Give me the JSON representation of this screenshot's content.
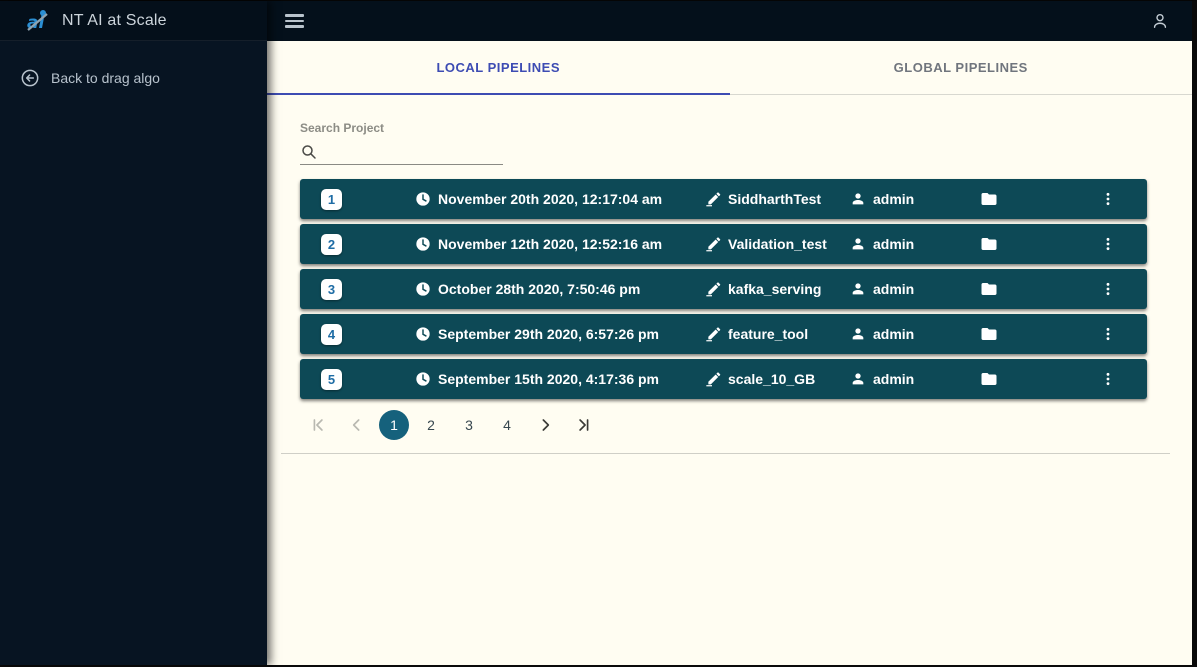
{
  "sidebar": {
    "logo_text": "NT AI at Scale",
    "back_label": "Back to drag algo"
  },
  "tabs": {
    "local": "LOCAL PIPELINES",
    "global": "GLOBAL PIPELINES"
  },
  "search": {
    "label": "Search Project",
    "value": ""
  },
  "pipelines": {
    "rows": [
      {
        "index": "1",
        "date": "November 20th 2020, 12:17:04 am",
        "name": "SiddharthTest",
        "owner": "admin"
      },
      {
        "index": "2",
        "date": "November 12th 2020, 12:52:16 am",
        "name": "Validation_test",
        "owner": "admin"
      },
      {
        "index": "3",
        "date": "October 28th 2020, 7:50:46 pm",
        "name": "kafka_serving",
        "owner": "admin"
      },
      {
        "index": "4",
        "date": "September 29th 2020, 6:57:26 pm",
        "name": "feature_tool",
        "owner": "admin"
      },
      {
        "index": "5",
        "date": "September 15th 2020, 4:17:36 pm",
        "name": "scale_10_GB",
        "owner": "admin"
      }
    ]
  },
  "pagination": {
    "pages": [
      "1",
      "2",
      "3",
      "4"
    ],
    "active_page": "1"
  },
  "colors": {
    "sidebar_bg": "#071422",
    "topbar_bg": "#04101b",
    "main_bg": "#fffdf2",
    "row_teal": "#0d4956",
    "accent_indigo": "#3d4cb3",
    "badge_number": "#1e6ca5",
    "pagination_active": "#15617c"
  }
}
